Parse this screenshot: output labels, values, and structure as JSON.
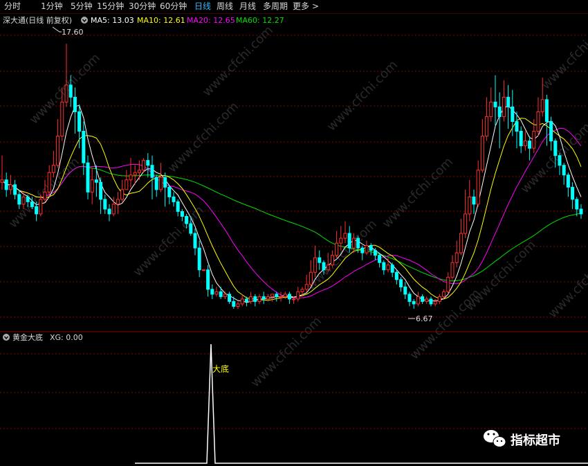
{
  "toolbar": {
    "tabs": [
      "分时",
      "1分钟",
      "5分钟",
      "15分钟",
      "30分钟",
      "60分钟",
      "日线",
      "周线",
      "月线",
      "多周期",
      "更多"
    ],
    "active": "日线",
    "more_arrow": ">"
  },
  "stock": {
    "title": "深大通(日线 前复权)",
    "ma_legend": [
      {
        "label": "MA5: 13.03",
        "color": "#ffffff"
      },
      {
        "label": "MA10: 12.61",
        "color": "#ffff00"
      },
      {
        "label": "MA20: 12.65",
        "color": "#ff00ff"
      },
      {
        "label": "MA60: 12.27",
        "color": "#00e000"
      }
    ],
    "high_label": "17.60",
    "low_label": "6.67"
  },
  "indicator": {
    "title": "黄金大底",
    "value_label": "XG: 0.00",
    "signal_label": "大底"
  },
  "watermark": {
    "text": "www.cfchi.com",
    "badge": "指标超市"
  },
  "colors": {
    "up": "#ff3030",
    "down": "#00ffff",
    "ma5": "#ffffff",
    "ma10": "#ffff00",
    "ma20": "#ff00ff",
    "ma60": "#00e000",
    "grid": "#8a0000"
  },
  "chart_data": {
    "type": "candlestick",
    "price_range": [
      6.3,
      18.2
    ],
    "candles": [
      [
        11.9,
        12.0,
        13.0,
        11.6
      ],
      [
        12.0,
        11.6,
        12.3,
        11.3
      ],
      [
        11.6,
        11.8,
        12.2,
        11.4
      ],
      [
        11.8,
        11.4,
        12.0,
        11.2
      ],
      [
        11.4,
        11.0,
        11.6,
        10.8
      ],
      [
        11.0,
        11.3,
        11.5,
        10.8
      ],
      [
        11.3,
        11.1,
        11.4,
        10.9
      ],
      [
        11.1,
        10.9,
        11.3,
        10.8
      ],
      [
        10.9,
        10.6,
        11.1,
        10.3
      ],
      [
        10.6,
        11.2,
        11.4,
        10.5
      ],
      [
        11.2,
        11.5,
        12.0,
        11.1
      ],
      [
        11.5,
        12.3,
        12.6,
        11.3
      ],
      [
        12.3,
        12.6,
        13.2,
        12.1
      ],
      [
        12.6,
        13.8,
        14.5,
        12.5
      ],
      [
        13.8,
        15.2,
        15.8,
        13.6
      ],
      [
        15.2,
        15.9,
        17.6,
        15.0
      ],
      [
        15.9,
        15.4,
        16.3,
        15.0
      ],
      [
        15.4,
        14.8,
        15.8,
        13.9
      ],
      [
        14.8,
        14.0,
        15.1,
        13.3
      ],
      [
        14.0,
        12.7,
        14.4,
        12.2
      ],
      [
        12.7,
        11.5,
        13.0,
        11.2
      ],
      [
        11.5,
        12.0,
        12.5,
        11.0
      ],
      [
        12.0,
        11.9,
        12.6,
        11.3
      ],
      [
        11.9,
        11.2,
        12.1,
        10.6
      ],
      [
        11.2,
        10.8,
        11.4,
        10.6
      ],
      [
        10.8,
        10.6,
        11.0,
        10.3
      ],
      [
        10.6,
        11.0,
        11.3,
        10.5
      ],
      [
        11.0,
        11.2,
        11.5,
        10.6
      ],
      [
        11.2,
        11.6,
        12.0,
        11.1
      ],
      [
        11.6,
        12.0,
        12.4,
        11.6
      ],
      [
        12.0,
        12.2,
        12.9,
        11.7
      ],
      [
        12.2,
        12.3,
        12.6,
        11.8
      ],
      [
        12.3,
        12.4,
        12.8,
        12.0
      ],
      [
        12.4,
        12.8,
        12.9,
        12.3
      ],
      [
        12.8,
        12.6,
        13.1,
        12.1
      ],
      [
        12.6,
        12.1,
        13.0,
        11.2
      ],
      [
        12.1,
        11.6,
        12.2,
        11.3
      ],
      [
        11.6,
        12.1,
        12.7,
        11.5
      ],
      [
        12.1,
        11.7,
        12.3,
        10.9
      ],
      [
        11.7,
        11.3,
        11.8,
        11.0
      ],
      [
        11.3,
        11.1,
        11.5,
        10.9
      ],
      [
        11.1,
        10.7,
        11.2,
        10.5
      ],
      [
        10.7,
        10.5,
        10.8,
        10.3
      ],
      [
        10.5,
        10.2,
        10.6,
        10.0
      ],
      [
        10.2,
        9.8,
        10.5,
        9.7
      ],
      [
        9.8,
        9.2,
        10.0,
        8.9
      ],
      [
        9.2,
        8.3,
        9.5,
        8.0
      ],
      [
        8.3,
        8.3,
        8.3,
        8.3
      ],
      [
        8.3,
        7.5,
        8.5,
        7.2
      ],
      [
        7.5,
        7.3,
        7.7,
        7.1
      ],
      [
        7.3,
        7.4,
        7.6,
        7.2
      ],
      [
        7.4,
        7.2,
        7.6,
        7.1
      ],
      [
        7.2,
        7.3,
        7.4,
        7.1
      ],
      [
        7.3,
        7.0,
        7.4,
        6.9
      ],
      [
        7.0,
        6.8,
        7.2,
        6.7
      ],
      [
        6.8,
        6.9,
        7.0,
        6.7
      ],
      [
        6.9,
        7.1,
        7.3,
        6.8
      ],
      [
        7.1,
        7.0,
        7.2,
        6.8
      ],
      [
        7.0,
        7.2,
        7.4,
        6.9
      ],
      [
        7.2,
        7.0,
        7.3,
        6.8
      ],
      [
        7.0,
        7.2,
        7.3,
        6.9
      ],
      [
        7.2,
        7.1,
        7.4,
        6.9
      ],
      [
        7.1,
        7.2,
        7.3,
        7.0
      ],
      [
        7.2,
        7.3,
        7.3,
        7.0
      ],
      [
        7.3,
        7.2,
        7.4,
        7.0
      ],
      [
        7.2,
        7.2,
        7.4,
        7.0
      ],
      [
        7.2,
        7.3,
        7.4,
        7.1
      ],
      [
        7.3,
        7.1,
        7.4,
        6.9
      ],
      [
        7.1,
        7.1,
        7.2,
        6.9
      ],
      [
        7.1,
        7.4,
        7.6,
        7.0
      ],
      [
        7.4,
        7.5,
        7.6,
        7.2
      ],
      [
        7.5,
        7.7,
        8.1,
        7.4
      ],
      [
        7.7,
        8.2,
        8.7,
        7.6
      ],
      [
        8.2,
        8.8,
        9.3,
        8.0
      ],
      [
        8.8,
        8.6,
        9.1,
        8.3
      ],
      [
        8.6,
        8.3,
        8.7,
        8.1
      ],
      [
        8.3,
        8.5,
        9.0,
        8.2
      ],
      [
        8.5,
        8.9,
        9.1,
        8.4
      ],
      [
        8.9,
        9.4,
        9.9,
        8.8
      ],
      [
        9.4,
        9.6,
        10.1,
        9.1
      ],
      [
        9.6,
        9.8,
        10.3,
        9.4
      ],
      [
        9.8,
        9.2,
        10.1,
        9.0
      ],
      [
        9.2,
        9.6,
        9.8,
        9.0
      ],
      [
        9.6,
        9.2,
        9.7,
        9.0
      ],
      [
        9.2,
        9.0,
        9.3,
        8.7
      ],
      [
        9.0,
        9.3,
        9.5,
        8.9
      ],
      [
        9.3,
        9.1,
        9.4,
        8.9
      ],
      [
        9.1,
        8.9,
        9.2,
        8.7
      ],
      [
        8.9,
        8.6,
        9.0,
        8.4
      ],
      [
        8.6,
        8.3,
        8.7,
        8.1
      ],
      [
        8.3,
        8.5,
        8.8,
        8.2
      ],
      [
        8.5,
        8.2,
        8.6,
        8.0
      ],
      [
        8.2,
        7.9,
        8.3,
        7.7
      ],
      [
        7.9,
        7.6,
        8.0,
        7.4
      ],
      [
        7.6,
        7.3,
        7.8,
        7.1
      ],
      [
        7.3,
        7.0,
        7.4,
        6.8
      ],
      [
        7.0,
        6.9,
        7.1,
        6.7
      ],
      [
        6.9,
        7.2,
        7.4,
        6.8
      ],
      [
        7.2,
        7.0,
        7.3,
        6.9
      ],
      [
        7.0,
        7.1,
        7.2,
        6.9
      ],
      [
        7.1,
        6.9,
        7.2,
        6.8
      ],
      [
        6.9,
        7.0,
        7.1,
        6.8
      ],
      [
        7.0,
        7.2,
        7.3,
        6.9
      ],
      [
        7.2,
        7.4,
        7.5,
        7.1
      ],
      [
        7.4,
        8.0,
        8.2,
        7.3
      ],
      [
        8.0,
        8.6,
        8.9,
        7.9
      ],
      [
        8.6,
        9.0,
        9.5,
        8.4
      ],
      [
        9.0,
        9.8,
        10.4,
        8.9
      ],
      [
        9.8,
        10.6,
        11.6,
        9.6
      ],
      [
        10.6,
        11.3,
        12.0,
        10.3
      ],
      [
        11.3,
        11.0,
        11.6,
        10.6
      ],
      [
        11.0,
        12.4,
        12.8,
        10.9
      ],
      [
        12.4,
        13.8,
        14.5,
        12.3
      ],
      [
        13.8,
        14.6,
        15.4,
        13.6
      ],
      [
        14.6,
        15.2,
        15.8,
        14.4
      ],
      [
        15.2,
        15.0,
        16.3,
        14.2
      ],
      [
        15.0,
        14.6,
        15.6,
        13.3
      ],
      [
        14.6,
        15.4,
        16.1,
        14.4
      ],
      [
        15.4,
        15.0,
        15.9,
        14.1
      ],
      [
        15.0,
        14.4,
        15.7,
        13.8
      ],
      [
        14.4,
        14.0,
        14.8,
        13.3
      ],
      [
        14.0,
        13.4,
        14.2,
        13.1
      ],
      [
        13.4,
        13.6,
        14.0,
        13.2
      ],
      [
        13.6,
        13.3,
        13.8,
        12.8
      ],
      [
        13.3,
        14.0,
        14.5,
        13.1
      ],
      [
        14.0,
        14.8,
        15.4,
        13.8
      ],
      [
        14.8,
        15.3,
        16.2,
        14.6
      ],
      [
        15.3,
        14.4,
        15.5,
        13.4
      ],
      [
        14.4,
        13.6,
        14.6,
        13.2
      ],
      [
        13.6,
        13.0,
        13.7,
        12.5
      ],
      [
        13.0,
        12.6,
        13.1,
        12.2
      ],
      [
        12.6,
        12.2,
        12.7,
        11.8
      ],
      [
        12.2,
        11.7,
        12.3,
        11.3
      ],
      [
        11.7,
        11.2,
        11.9,
        10.8
      ],
      [
        11.2,
        10.8,
        11.3,
        10.5
      ],
      [
        10.8,
        10.6,
        11.0,
        10.4
      ]
    ],
    "ma5_last": 13.03,
    "ma10_last": 12.61,
    "ma20_last": 12.65,
    "ma60_last": 12.27,
    "indicator_series": {
      "name": "XG",
      "signal_index": 54,
      "range": [
        0,
        1
      ]
    }
  }
}
